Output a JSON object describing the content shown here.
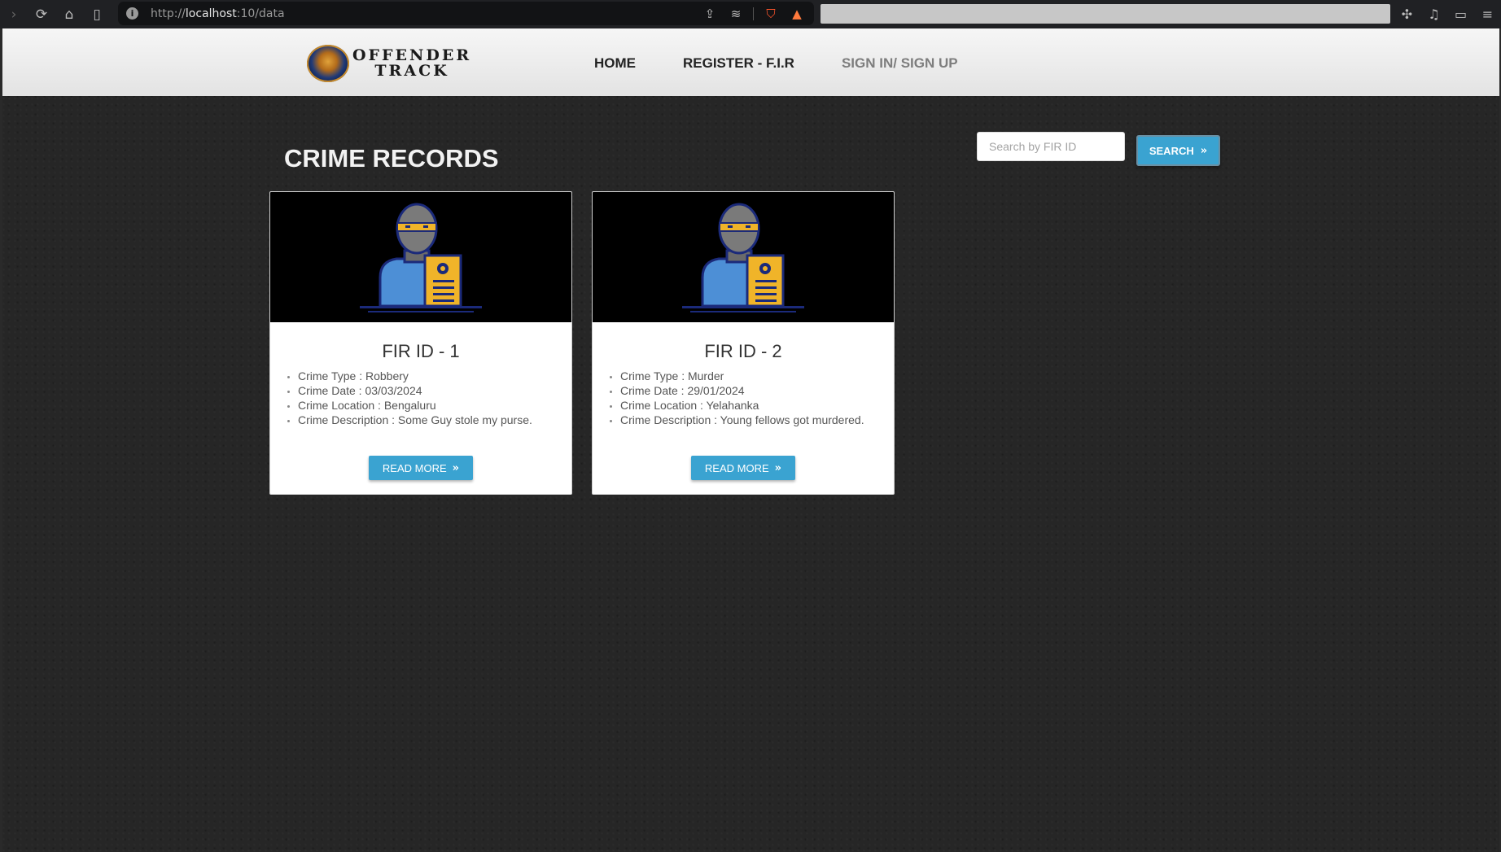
{
  "browser": {
    "url_prefix": "http://",
    "url_host": "localhost",
    "url_path": ":10/data"
  },
  "site": {
    "logo_line1": "OFFENDER",
    "logo_line2": "TRACK",
    "nav": {
      "home": "HOME",
      "register": "REGISTER - F.I.R",
      "signin": "SIGN IN/ SIGN UP"
    }
  },
  "main": {
    "title": "CRIME RECORDS",
    "search_placeholder": "Search by FIR ID",
    "search_label": "SEARCH"
  },
  "records": [
    {
      "title": "FIR ID - 1",
      "type": "Crime Type : Robbery",
      "date": "Crime Date : 03/03/2024",
      "location": "Crime Location : Bengaluru",
      "description": "Crime Description : Some Guy stole my purse.",
      "button": "READ MORE"
    },
    {
      "title": "FIR ID - 2",
      "type": "Crime Type : Murder",
      "date": "Crime Date : 29/01/2024",
      "location": "Crime Location : Yelahanka",
      "description": "Crime Description : Young fellows got murdered.",
      "button": "READ MORE"
    }
  ],
  "colors": {
    "accent": "#3aa3d1",
    "background": "#262626",
    "header": "#eeeeee"
  }
}
